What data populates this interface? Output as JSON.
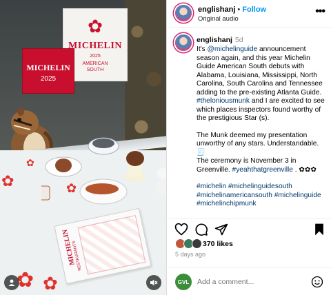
{
  "photo": {
    "sign_white": {
      "brand": "MICHELIN",
      "year": "2025",
      "region_line1": "AMERICAN",
      "region_line2": "SOUTH"
    },
    "sign_red": {
      "brand": "MICHELIN",
      "year": "2025"
    },
    "magazine": {
      "title": "MICHELIN",
      "subtitle": "RESTAURANTS"
    }
  },
  "header": {
    "username": "englishanj",
    "separator": "•",
    "follow_label": "Follow",
    "audio": "Original audio",
    "more": "•••"
  },
  "caption": {
    "username": "englishanj",
    "time": "5d",
    "p1": [
      {
        "t": "It's "
      },
      {
        "t": "@michelinguide",
        "link": true
      },
      {
        "t": " announcement season again, and this year Michelin Guide American South debuts with Alabama, Louisiana, Mississippi, North Carolina, South Carolina and Tennessee adding to the pre-existing Atlanta Guide. "
      },
      {
        "t": "#theloniousmunk",
        "link": true
      },
      {
        "t": " and I are excited to see which places inspectors found worthy of the prestigious Star (s)."
      }
    ],
    "p2": [
      {
        "t": "The Munk deemed my presentation unworthy of any stars. Understandable. 🧾"
      },
      {
        "br": true
      },
      {
        "t": "The ceremony is November 3 in Greenville. "
      },
      {
        "t": "#yeahthatgreenville",
        "link": true
      },
      {
        "t": " . ✿✿✿"
      }
    ],
    "p3": [
      {
        "t": "#michelin",
        "link": true
      },
      {
        "t": " "
      },
      {
        "t": "#michelinguidesouth",
        "link": true
      },
      {
        "t": " "
      },
      {
        "t": "#michelinamericansouth",
        "link": true
      },
      {
        "t": " "
      },
      {
        "t": "#michelinguide",
        "link": true
      },
      {
        "t": " "
      },
      {
        "t": "#michelinchipmunk",
        "link": true
      }
    ]
  },
  "likes": {
    "count_label": "370 likes"
  },
  "time_ago": "5 days ago",
  "comment": {
    "avatar_text": "GVL",
    "placeholder": "Add a comment..."
  },
  "colors": {
    "accent": "#0095f6",
    "link": "#00376b",
    "michelin_red": "#c8102e",
    "muted": "#8e8e8e"
  }
}
